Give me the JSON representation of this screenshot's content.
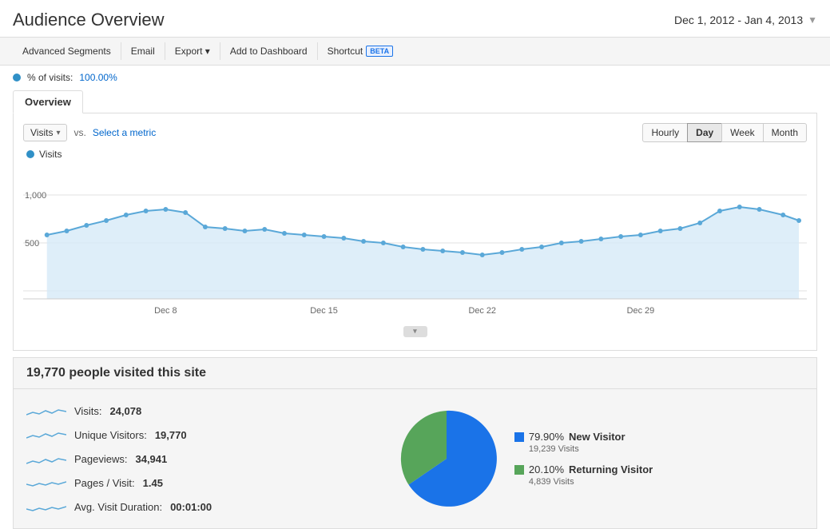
{
  "header": {
    "title": "Audience Overview",
    "date_range": "Dec 1, 2012 - Jan 4, 2013"
  },
  "toolbar": {
    "advanced_segments": "Advanced Segments",
    "email": "Email",
    "export": "Export",
    "export_arrow": "▾",
    "add_to_dashboard": "Add to Dashboard",
    "shortcut": "Shortcut",
    "beta": "BETA"
  },
  "filter": {
    "label": "% of visits:",
    "value": "100.00%"
  },
  "tabs": [
    {
      "label": "Overview",
      "active": true
    }
  ],
  "chart": {
    "metric_label": "Visits",
    "vs_text": "vs.",
    "select_metric": "Select a metric",
    "time_buttons": [
      "Hourly",
      "Day",
      "Week",
      "Month"
    ],
    "active_time": "Day",
    "y_labels": [
      "1,000",
      "500"
    ],
    "x_labels": [
      "Dec 8",
      "Dec 15",
      "Dec 22",
      "Dec 29"
    ],
    "legend": "Visits"
  },
  "stats": {
    "header": "19,770 people visited this site",
    "items": [
      {
        "label": "Visits:",
        "value": "24,078"
      },
      {
        "label": "Unique Visitors:",
        "value": "19,770"
      },
      {
        "label": "Pageviews:",
        "value": "34,941"
      },
      {
        "label": "Pages / Visit:",
        "value": "1.45"
      },
      {
        "label": "Avg. Visit Duration:",
        "value": "00:01:00"
      }
    ]
  },
  "pie": {
    "new_visitor_pct": "79.90%",
    "new_visitor_label": "New Visitor",
    "new_visitor_visits": "19,239 Visits",
    "returning_visitor_pct": "20.10%",
    "returning_visitor_label": "Returning Visitor",
    "returning_visitor_visits": "4,839 Visits",
    "new_color": "#1a73e8",
    "returning_color": "#57a55a"
  },
  "colors": {
    "accent_blue": "#3090c7",
    "line_color": "#5aa8d8",
    "area_fill": "#d6eaf8"
  }
}
